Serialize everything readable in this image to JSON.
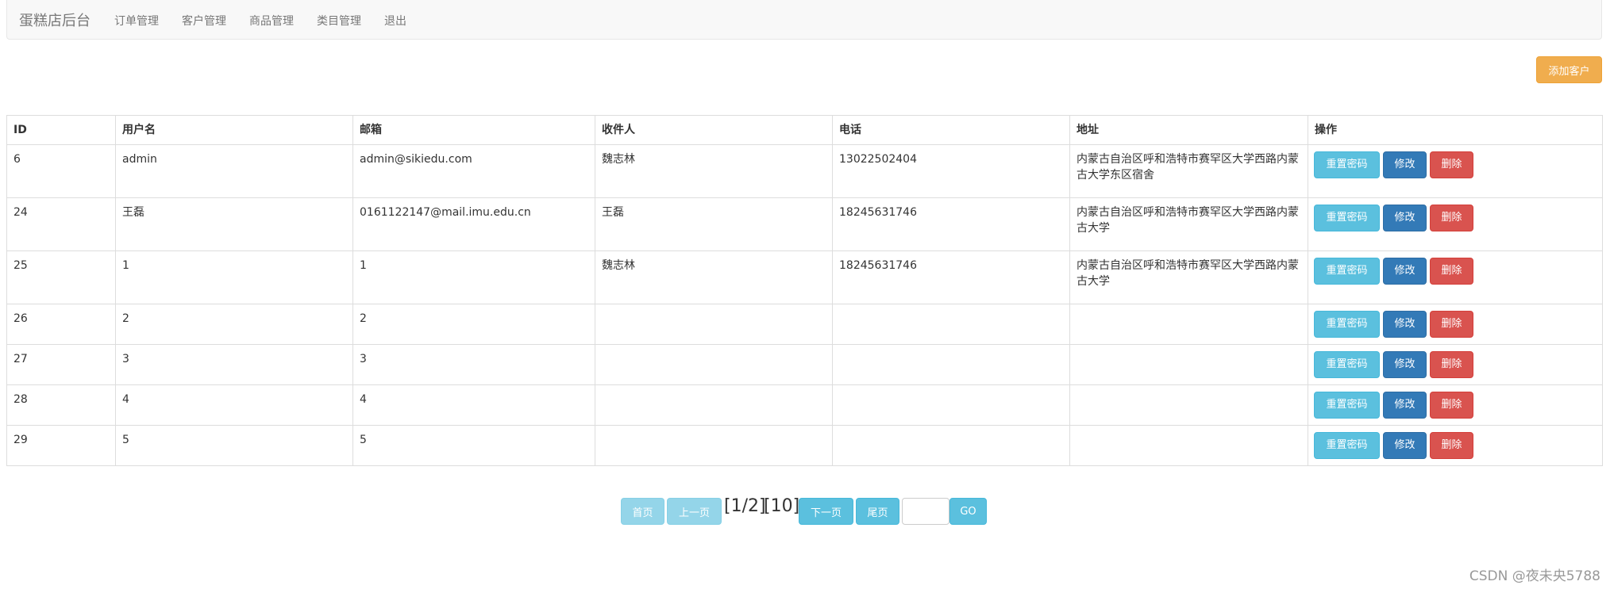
{
  "navbar": {
    "brand": "蛋糕店后台",
    "links": [
      "订单管理",
      "客户管理",
      "商品管理",
      "类目管理",
      "退出"
    ]
  },
  "actions": {
    "add_customer": "添加客户"
  },
  "table": {
    "headers": [
      "ID",
      "用户名",
      "邮箱",
      "收件人",
      "电话",
      "地址",
      "操作"
    ],
    "rows": [
      {
        "id": "6",
        "username": "admin",
        "email": "admin@sikiedu.com",
        "receiver": "魏志林",
        "phone": "13022502404",
        "address": "内蒙古自治区呼和浩特市赛罕区大学西路内蒙古大学东区宿舍"
      },
      {
        "id": "24",
        "username": "王磊",
        "email": "0161122147@mail.imu.edu.cn",
        "receiver": "王磊",
        "phone": "18245631746",
        "address": "内蒙古自治区呼和浩特市赛罕区大学西路内蒙古大学"
      },
      {
        "id": "25",
        "username": "1",
        "email": "1",
        "receiver": "魏志林",
        "phone": "18245631746",
        "address": "内蒙古自治区呼和浩特市赛罕区大学西路内蒙古大学"
      },
      {
        "id": "26",
        "username": "2",
        "email": "2",
        "receiver": "",
        "phone": "",
        "address": ""
      },
      {
        "id": "27",
        "username": "3",
        "email": "3",
        "receiver": "",
        "phone": "",
        "address": ""
      },
      {
        "id": "28",
        "username": "4",
        "email": "4",
        "receiver": "",
        "phone": "",
        "address": ""
      },
      {
        "id": "29",
        "username": "5",
        "email": "5",
        "receiver": "",
        "phone": "",
        "address": ""
      }
    ],
    "row_actions": {
      "reset_password": "重置密码",
      "edit": "修改",
      "delete": "删除"
    }
  },
  "pagination": {
    "first": "首页",
    "prev": "上一页",
    "page_info": "[1/2]",
    "total": "[10]",
    "next": "下一页",
    "last": "尾页",
    "go": "GO",
    "input_value": ""
  },
  "watermark": "CSDN @夜未央5788",
  "colors": {
    "info": "#5bc0de",
    "primary": "#337ab7",
    "danger": "#d9534f",
    "warning": "#f0ad4e"
  }
}
